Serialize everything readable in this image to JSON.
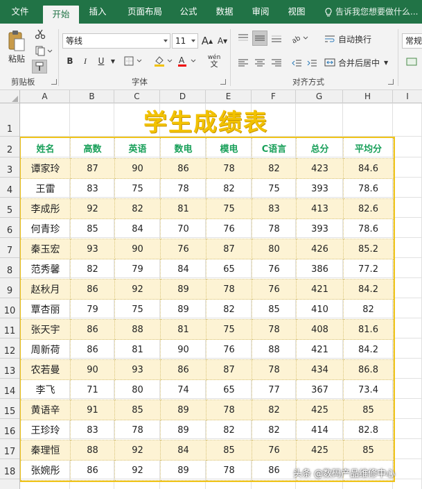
{
  "ribbon_tabs": [
    "文件",
    "开始",
    "插入",
    "页面布局",
    "公式",
    "数据",
    "审阅",
    "视图"
  ],
  "active_tab": "开始",
  "tell_me": "告诉我您想要做什么...",
  "clipboard": {
    "paste": "粘贴",
    "group": "剪贴板"
  },
  "font": {
    "name": "等线",
    "size": "11",
    "group": "字体",
    "grow": "A",
    "shrink": "A",
    "bold": "B",
    "italic": "I",
    "underline": "U",
    "wen": "wén"
  },
  "alignment": {
    "wrap": "自动换行",
    "merge": "合并后居中",
    "group": "对齐方式"
  },
  "number": {
    "format": "常规"
  },
  "columns": [
    "A",
    "B",
    "C",
    "D",
    "E",
    "F",
    "G",
    "H",
    "I"
  ],
  "rows": [
    "1",
    "2",
    "3",
    "4",
    "5",
    "6",
    "7",
    "8",
    "9",
    "10",
    "11",
    "12",
    "13",
    "14",
    "15",
    "16",
    "17",
    "18"
  ],
  "sheet": {
    "title": "学生成绩表",
    "headers": [
      "姓名",
      "高数",
      "英语",
      "数电",
      "模电",
      "C语言",
      "总分",
      "平均分"
    ],
    "data": [
      [
        "谭家玲",
        "87",
        "90",
        "86",
        "78",
        "82",
        "423",
        "84.6"
      ],
      [
        "王雷",
        "83",
        "75",
        "78",
        "82",
        "75",
        "393",
        "78.6"
      ],
      [
        "李成彤",
        "92",
        "82",
        "81",
        "75",
        "83",
        "413",
        "82.6"
      ],
      [
        "何青珍",
        "85",
        "84",
        "70",
        "76",
        "78",
        "393",
        "78.6"
      ],
      [
        "秦玉宏",
        "93",
        "90",
        "76",
        "87",
        "80",
        "426",
        "85.2"
      ],
      [
        "范秀馨",
        "82",
        "79",
        "84",
        "65",
        "76",
        "386",
        "77.2"
      ],
      [
        "赵秋月",
        "86",
        "92",
        "89",
        "78",
        "76",
        "421",
        "84.2"
      ],
      [
        "覃杏丽",
        "79",
        "75",
        "89",
        "82",
        "85",
        "410",
        "82"
      ],
      [
        "张天宇",
        "86",
        "88",
        "81",
        "75",
        "78",
        "408",
        "81.6"
      ],
      [
        "周新荷",
        "86",
        "81",
        "90",
        "76",
        "88",
        "421",
        "84.2"
      ],
      [
        "农若曼",
        "90",
        "93",
        "86",
        "87",
        "78",
        "434",
        "86.8"
      ],
      [
        "李飞",
        "71",
        "80",
        "74",
        "65",
        "77",
        "367",
        "73.4"
      ],
      [
        "黄语辛",
        "91",
        "85",
        "89",
        "78",
        "82",
        "425",
        "85"
      ],
      [
        "王珍玲",
        "83",
        "78",
        "89",
        "82",
        "82",
        "414",
        "82.8"
      ],
      [
        "秦理恒",
        "88",
        "92",
        "84",
        "85",
        "76",
        "425",
        "85"
      ],
      [
        "张婉彤",
        "86",
        "92",
        "89",
        "78",
        "86",
        "",
        ""
      ]
    ]
  },
  "watermark": "头条 @数码产品维修中心",
  "colors": {
    "ribbon_green": "#217346",
    "title_yellow": "#f2c200",
    "header_green": "#19a05a",
    "stripe": "#fdf3d4",
    "border": "#f0c419"
  }
}
